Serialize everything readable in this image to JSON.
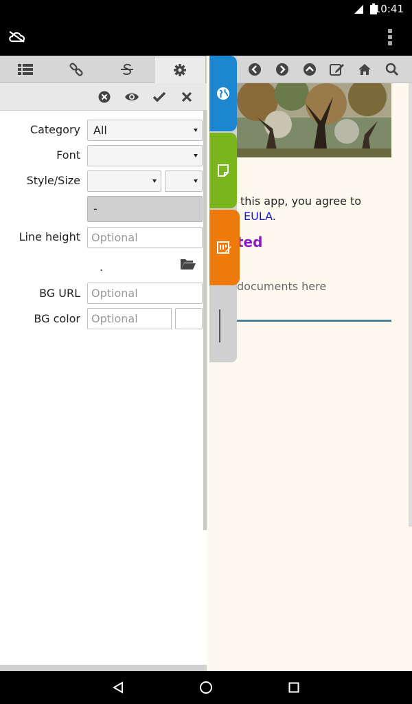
{
  "status_bar": {
    "time": "10:41"
  },
  "browser": {
    "eula_line1": "this app, you agree to",
    "eula_link": "EULA",
    "eula_period": ".",
    "heading_partial": "ted",
    "docs_text": "documents here"
  },
  "panel": {
    "fields": {
      "category": {
        "label": "Category",
        "value": "All"
      },
      "font": {
        "label": "Font",
        "value": ""
      },
      "style_size": {
        "label": "Style/Size",
        "style_value": "",
        "size_value": ""
      },
      "preview": {
        "value": "-"
      },
      "line_height": {
        "label": "Line height",
        "placeholder": "Optional"
      },
      "file": {
        "name": "."
      },
      "bg_url": {
        "label": "BG URL",
        "placeholder": "Optional"
      },
      "bg_color": {
        "label": "BG color",
        "placeholder": "Optional"
      }
    }
  },
  "colors": {
    "tab_globe": "#1c87d0",
    "tab_note": "#7ab51d",
    "tab_edit": "#ef7a0c",
    "heading": "#8a18c9",
    "link": "#1a1ad6"
  },
  "icons": [
    "cloud-off-icon",
    "overflow-menu-icon",
    "list-icon",
    "link-icon",
    "strikethrough-icon",
    "gear-icon",
    "clear-icon",
    "eye-icon",
    "check-icon",
    "close-icon",
    "back-icon",
    "forward-icon",
    "up-icon",
    "edit-icon",
    "home-icon",
    "search-icon",
    "globe-icon",
    "note-icon",
    "edit-note-icon",
    "folder-open-icon",
    "nav-back-icon",
    "nav-home-icon",
    "nav-recents-icon"
  ]
}
